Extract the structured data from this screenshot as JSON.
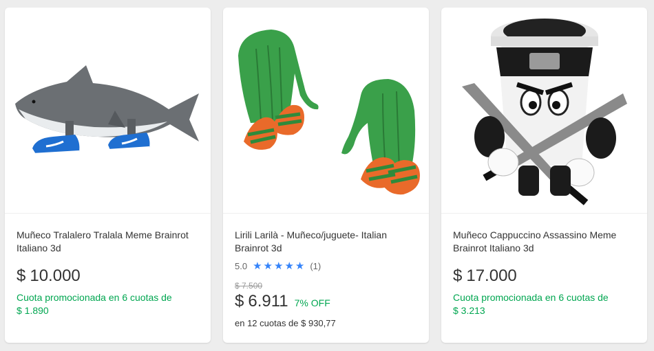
{
  "products": [
    {
      "title": "Muñeco Tralalero Tralala Meme Brainrot Italiano 3d",
      "currency": "$",
      "price": "10.000",
      "installments_line1": "Cuota promocionada en 6 cuotas de",
      "installments_line2": "$ 1.890",
      "image_icon": "shark-with-sneakers-image"
    },
    {
      "title": "Lirili Larilà - Muñeco/juguete- Italian Brainrot 3d",
      "rating_score": "5.0",
      "rating_value": 5,
      "rating_count": "(1)",
      "old_price": "$ 7.500",
      "currency": "$",
      "price": "6.911",
      "discount": "7% OFF",
      "installments": "en 12 cuotas de $ 930,77",
      "image_icon": "elephant-cactus-sandals-image"
    },
    {
      "title": "Muñeco Cappuccino Assassino Meme Brainrot Italiano 3d",
      "currency": "$",
      "price": "17.000",
      "installments_line1": "Cuota promocionada en 6 cuotas de",
      "installments_line2": "$ 3.213",
      "image_icon": "cappuccino-ninja-image"
    }
  ],
  "colors": {
    "accent": "#3483fa",
    "green": "#00a650",
    "background": "#ededed"
  }
}
